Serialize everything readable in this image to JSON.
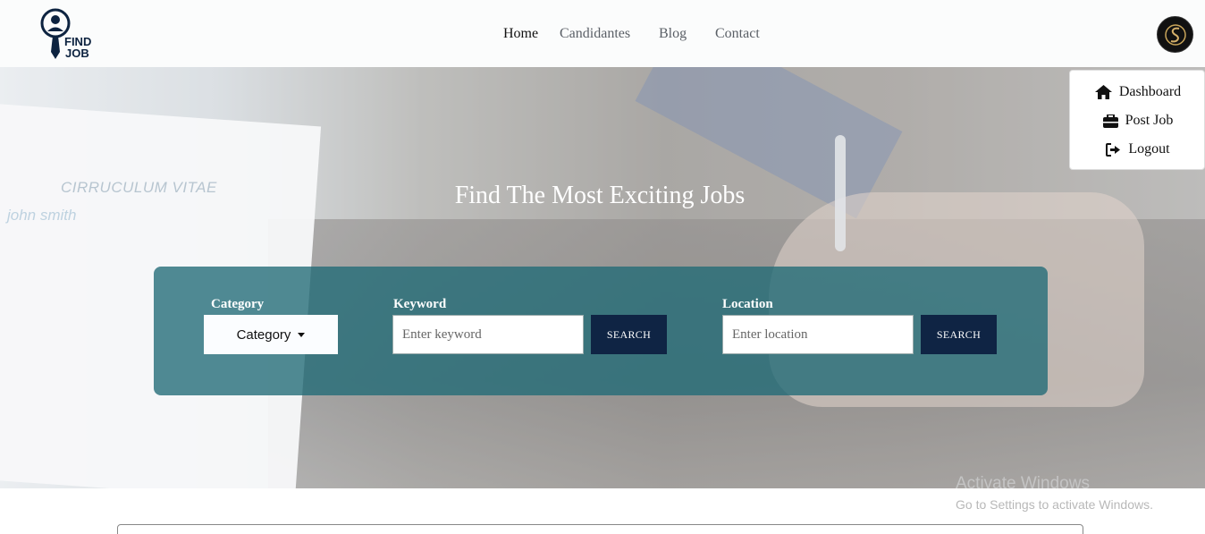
{
  "brand": {
    "logo_line1": "FIND",
    "logo_line2": "JOB",
    "logo_icon": "magnifier-person-icon"
  },
  "nav": {
    "home": "Home",
    "candidates": "Candidantes",
    "blog": "Blog",
    "contact": "Contact"
  },
  "avatar": {
    "icon": "signature-avatar-icon"
  },
  "menu": {
    "dashboard": "Dashboard",
    "dashboard_icon": "home-icon",
    "post_job": "Post Job",
    "post_job_icon": "briefcase-icon",
    "logout": "Logout",
    "logout_icon": "sign-out-icon"
  },
  "hero": {
    "title": "Find The Most Exciting Jobs",
    "cv_title": "CIRRUCULUM VITAE",
    "cv_name": "john smith"
  },
  "search": {
    "category_label": "Category",
    "category_button": "Category",
    "keyword_label": "Keyword",
    "keyword_placeholder": "Enter keyword",
    "location_label": "Location",
    "location_placeholder": "Enter location",
    "search_label": "SEARCH"
  },
  "watermark": {
    "line1": "Activate Windows",
    "line2": "Go to Settings to activate Windows."
  },
  "colors": {
    "panel": "#206a76",
    "button": "#0f2444",
    "brand": "#0d2340"
  }
}
